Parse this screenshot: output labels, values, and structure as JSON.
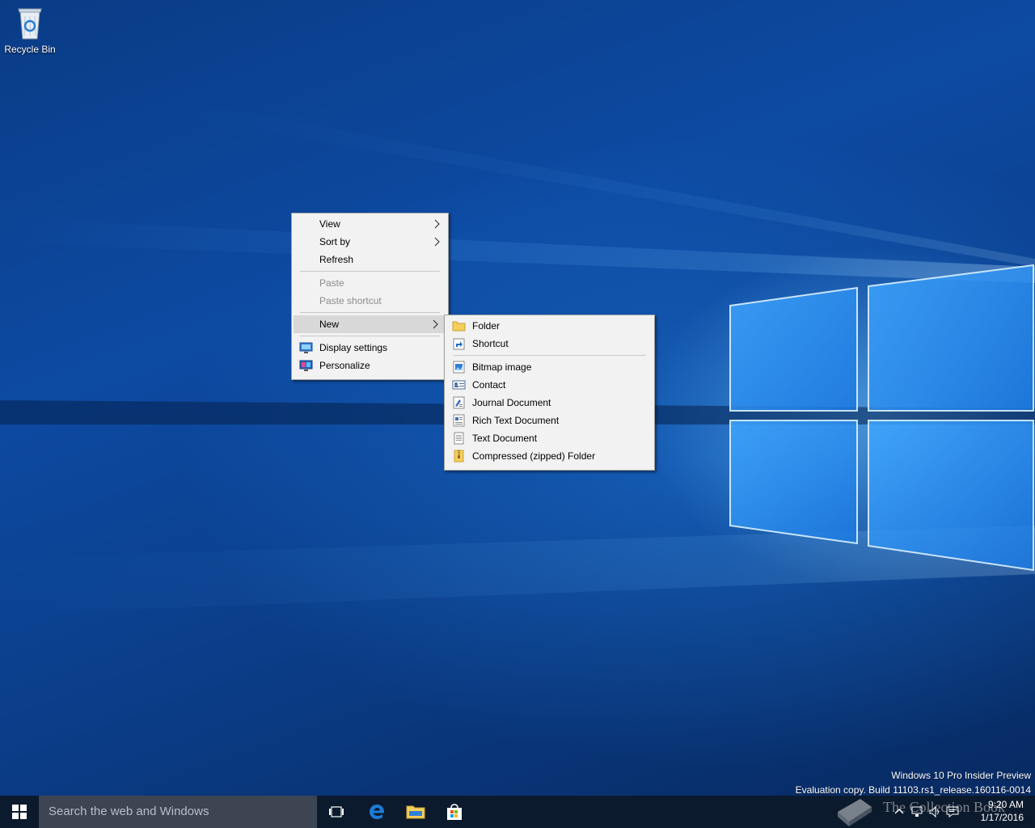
{
  "desktop": {
    "icons": [
      {
        "label": "Recycle Bin",
        "icon": "recycle-bin-icon"
      }
    ]
  },
  "context_menu": {
    "items": [
      {
        "label": "View",
        "has_submenu": true
      },
      {
        "label": "Sort by",
        "has_submenu": true
      },
      {
        "label": "Refresh"
      },
      {
        "label": "Paste",
        "disabled": true
      },
      {
        "label": "Paste shortcut",
        "disabled": true
      },
      {
        "label": "New",
        "has_submenu": true,
        "highlighted": true
      },
      {
        "label": "Display settings",
        "icon": "display-settings-icon"
      },
      {
        "label": "Personalize",
        "icon": "personalize-icon"
      }
    ]
  },
  "new_submenu": {
    "items": [
      {
        "label": "Folder",
        "icon": "folder-icon"
      },
      {
        "label": "Shortcut",
        "icon": "shortcut-icon"
      },
      {
        "label": "Bitmap image",
        "icon": "bitmap-image-icon"
      },
      {
        "label": "Contact",
        "icon": "contact-icon"
      },
      {
        "label": "Journal Document",
        "icon": "journal-document-icon"
      },
      {
        "label": "Rich Text Document",
        "icon": "rich-text-document-icon"
      },
      {
        "label": "Text Document",
        "icon": "text-document-icon"
      },
      {
        "label": "Compressed (zipped) Folder",
        "icon": "zip-folder-icon"
      }
    ]
  },
  "watermark": {
    "line1": "Windows 10 Pro Insider Preview",
    "line2": "Evaluation copy. Build 11103.rs1_release.160116-0014"
  },
  "taskbar": {
    "search_placeholder": "Search the web and Windows",
    "pinned": [
      "task-view-icon",
      "edge-icon",
      "file-explorer-icon",
      "store-icon"
    ],
    "clock_time": "9:20 AM",
    "clock_date": "1/17/2016",
    "brand_text": "The Collection Book"
  },
  "colors": {
    "taskbar": "#0c1a2d",
    "search_box": "#3d4452",
    "menu_bg": "#f2f2f2",
    "menu_highlight": "#d8d8d8",
    "edge_blue": "#1e7bd6",
    "folder_yellow": "#f6cf5a"
  }
}
